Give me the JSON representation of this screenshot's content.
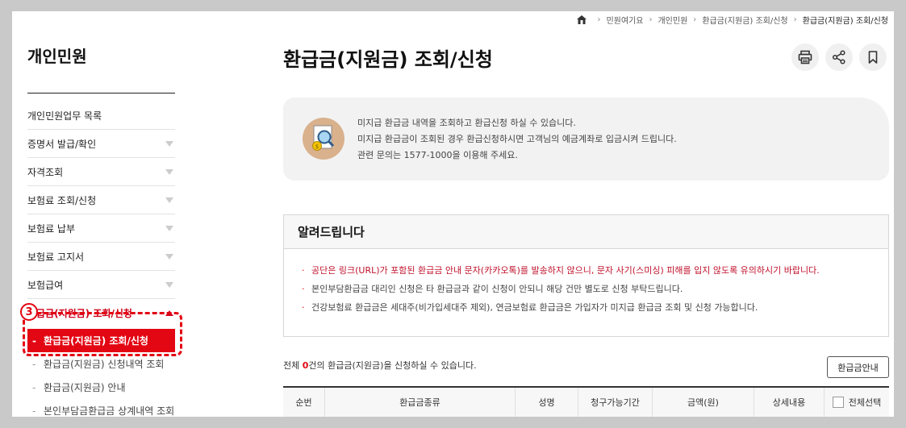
{
  "breadcrumb": {
    "home_icon": "home-icon",
    "items": [
      "민원여기요",
      "개인민원",
      "환급금(지원금) 조회/신청",
      "환급금(지원금) 조회/신청"
    ]
  },
  "sidebar": {
    "title": "개인민원",
    "items": [
      {
        "label": "개인민원업무 목록"
      },
      {
        "label": "증명서 발급/확인"
      },
      {
        "label": "자격조회"
      },
      {
        "label": "보험료 조회/신청"
      },
      {
        "label": "보험료 납부"
      },
      {
        "label": "보험료 고지서"
      },
      {
        "label": "보험급여"
      },
      {
        "label": "환급금(지원금) 조회/신청"
      }
    ],
    "sub_items": [
      {
        "label": "환급금(지원금) 조회/신청"
      },
      {
        "label": "환급금(지원금) 신청내역 조회"
      },
      {
        "label": "환급금(지원금) 안내"
      },
      {
        "label": "본인부담금환급금 상계내역 조회"
      }
    ],
    "callout_number": "3"
  },
  "main": {
    "title": "환급금(지원금) 조회/신청",
    "tools": [
      "print-icon",
      "share-icon",
      "bookmark-icon"
    ],
    "info_lines": [
      "미지급 환급금 내역을 조회하고 환급신청 하실 수 있습니다.",
      "미지급 환급금이 조회된 경우 환급신청하시면 고객님의 예금계좌로 입금시켜 드립니다.",
      "관련 문의는 1577-1000을 이용해 주세요."
    ],
    "notice_title": "알려드립니다",
    "notice_lines": [
      "공단은 링크(URL)가 포함된 환급금 안내 문자(카카오톡)를 발송하지 않으니, 문자 사기(스미싱) 피해를 입지 않도록 유의하시기 바랍니다.",
      "본인부담환급금 대리인 신청은 타 환급금과 같이 신청이 안되니 해당 건만 별도로 신청 부탁드립니다.",
      "건강보험료 환급금은 세대주(비가입세대주 제외), 연금보험료 환급금은 가입자가 미지급 환급금 조회 및 신청 가능합니다."
    ],
    "count_prefix": "전체 ",
    "count_value": "0",
    "count_suffix": "건의 환급금(지원금)을 신청하실 수 있습니다.",
    "guide_button": "환급금안내",
    "table_headers": [
      "순번",
      "환급금종류",
      "성명",
      "청구가능기간",
      "금액(원)",
      "상세내용",
      "전체선택"
    ]
  },
  "colors": {
    "accent": "#e30613",
    "notice_red": "#c0122c"
  }
}
